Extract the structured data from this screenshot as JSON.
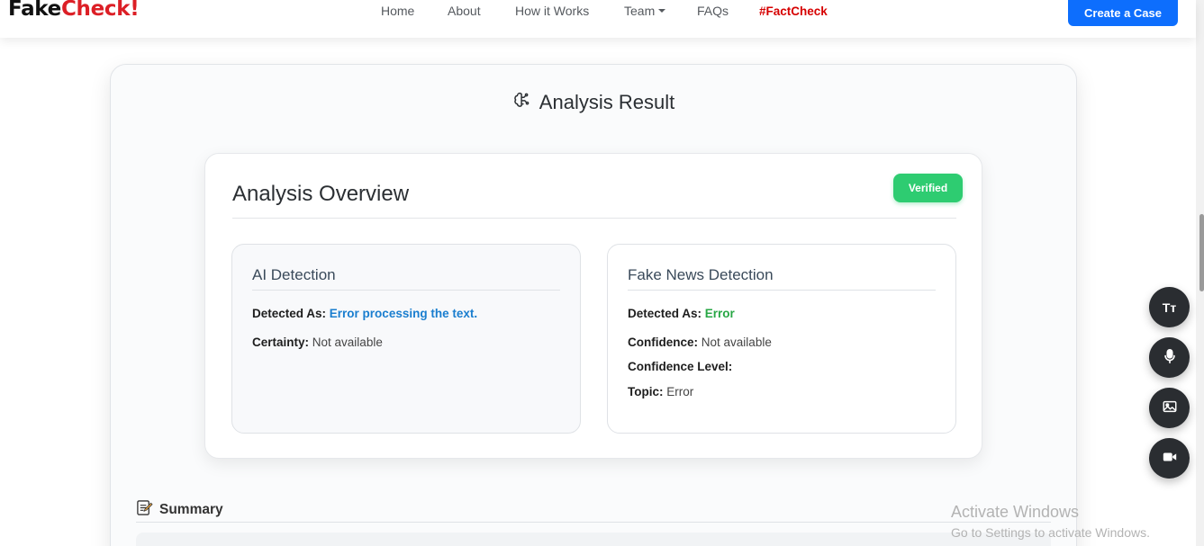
{
  "nav": {
    "brand_part1": "Fake",
    "brand_part2": "Check",
    "brand_part3": "!",
    "links": [
      "Home",
      "About",
      "How it Works",
      "Team",
      "FAQs",
      "#FactCheck"
    ],
    "cta": "Create a Case"
  },
  "result": {
    "title": "Analysis Result",
    "icon": "brain-icon"
  },
  "overview": {
    "title": "Analysis Overview",
    "badge": "Verified",
    "badge_color": "#2ecc71"
  },
  "ai_detection": {
    "title": "AI Detection",
    "detected_as_label": "Detected As:",
    "detected_as_value": "Error processing the text.",
    "certainty_label": "Certainty:",
    "certainty_value": "Not available"
  },
  "fake_news": {
    "title": "Fake News Detection",
    "detected_as_label": "Detected As:",
    "detected_as_value": "Error",
    "confidence_label": "Confidence:",
    "confidence_value": "Not available",
    "confidence_level_label": "Confidence Level:",
    "topic_label": "Topic:",
    "topic_value": "Error"
  },
  "summary": {
    "title": "Summary",
    "icon": "memo-icon"
  },
  "fabs": {
    "text_label": "Tт",
    "items": [
      "text-size-icon",
      "microphone-icon",
      "image-icon",
      "video-camera-icon"
    ]
  },
  "watermark": {
    "line1": "Activate Windows",
    "line2": "Go to Settings to activate Windows."
  },
  "colors": {
    "accent": "#0d6efd",
    "brand_red": "#dc1f26",
    "fact_red": "#d60000",
    "blue_value": "#1a7ecf",
    "green_value": "#28a745"
  }
}
